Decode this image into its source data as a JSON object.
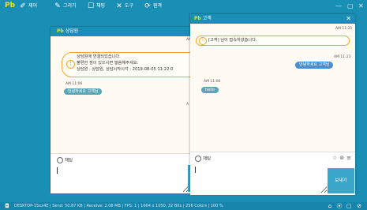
{
  "topbar": {
    "logo": "Pb",
    "items": [
      {
        "icon": "pointer-icon",
        "glyph": "✐",
        "label": "제어"
      },
      {
        "icon": "pen-icon",
        "glyph": "✎",
        "label": "그리기"
      },
      {
        "icon": "chat-icon",
        "glyph": "☐",
        "label": "채팅"
      },
      {
        "icon": "tools-icon",
        "glyph": "✕",
        "label": "도구"
      },
      {
        "icon": "pc-icon",
        "glyph": "⟳",
        "label": "원격"
      }
    ],
    "controls": [
      "—",
      "▢",
      "✕"
    ]
  },
  "window_agent": {
    "logo": "Pb",
    "title": "상담원",
    "time_notice": "AM",
    "notice_lines": [
      "상담원에 연결되었습니다.",
      "불편한 점이 있으시면 말씀해주세요.",
      "상담원 : 상담원, 상담시작시각 : 2019-08-05 11:22:0"
    ],
    "time_received": "AM 11:06",
    "received_message": "안녕하세요 고객님",
    "time_side": "A",
    "chat_label": "채팅",
    "input_placeholder": ""
  },
  "window_customer": {
    "logo": "Pb",
    "title": "고객",
    "close": "✕",
    "time_notice": "AM 11:21",
    "notice_text": "[고객] 님이 접속하셨습니다.",
    "time_sent": "AM 11:23",
    "sent_message": "안녕하세요 고객님",
    "time_received": "AM 11:06",
    "received_message": "hello",
    "chat_label": "채팅",
    "tools": [
      "☆",
      "⊚",
      "≡"
    ],
    "send_label": "보내기",
    "input_placeholder": ""
  },
  "statusbar": {
    "text": "DESKTOP-15xx4E | Send: 50.87 KB | Receive: 2.08 MB | FPS: 1 | 1664 x 1050, 32 Bits | 256 Colors | 100 %",
    "right_icons": [
      "⌂",
      "⦿",
      "▢",
      "⊘"
    ]
  },
  "colors": {
    "accent": "#1a8fb6",
    "notice_border": "#f5a623",
    "bubble_received": "#5aa5b6",
    "bubble_sent": "#4a8fd0",
    "send_button": "#3aa6c9"
  }
}
